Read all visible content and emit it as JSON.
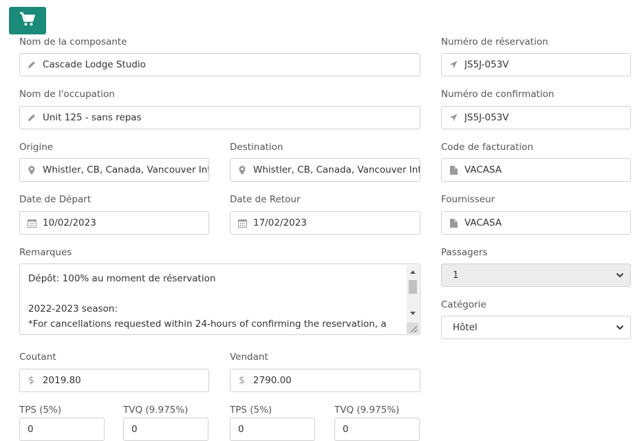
{
  "labels": {
    "component_name": "Nom de la composante",
    "reservation_number": "Numéro de réservation",
    "occupation_name": "Nom de l'occupation",
    "confirmation_number": "Numéro de confirmation",
    "origin": "Origine",
    "destination": "Destination",
    "billing_code": "Code de facturation",
    "departure_date": "Date de Départ",
    "return_date": "Date de Retour",
    "supplier": "Fournisseur",
    "remarks": "Remarques",
    "passengers": "Passagers",
    "category": "Catégorie",
    "cost": "Coutant",
    "selling": "Vendant",
    "tps1": "TPS (5%)",
    "tvq1": "TVQ (9.975%)",
    "tps2": "TPS (5%)",
    "tvq2": "TVQ (9.975%)"
  },
  "values": {
    "component_name": "Cascade Lodge Studio",
    "reservation_number": "JS5J-053V",
    "occupation_name": "Unit 125 - sans repas",
    "confirmation_number": "JS5J-053V",
    "origin": "Whistler, CB, Canada, Vancouver International Airport",
    "destination": "Whistler, CB, Canada, Vancouver International Airport",
    "billing_code": "VACASA",
    "departure_date": "10/02/2023",
    "return_date": "17/02/2023",
    "supplier": "VACASA",
    "remarks": "Dépôt: 100% au moment de réservation\n\n2022-2023 season:\n*For cancellations requested within 24-hours of confirming the reservation, a full refund",
    "passengers": "1",
    "category": "Hôtel",
    "cost": "2019.80",
    "selling": "2790.00",
    "tps1": "0",
    "tvq1": "0",
    "tps2": "0",
    "tvq2": "0"
  },
  "symbols": {
    "currency": "$"
  },
  "icons": {
    "cart": "cart-icon",
    "pencil": "pencil-icon",
    "location_arrow": "location-arrow-icon",
    "map_marker": "map-marker-icon",
    "calendar": "calendar-icon",
    "file": "file-icon",
    "chevron": "chevron-down-icon"
  },
  "colors": {
    "accent": "#1a8a79"
  }
}
